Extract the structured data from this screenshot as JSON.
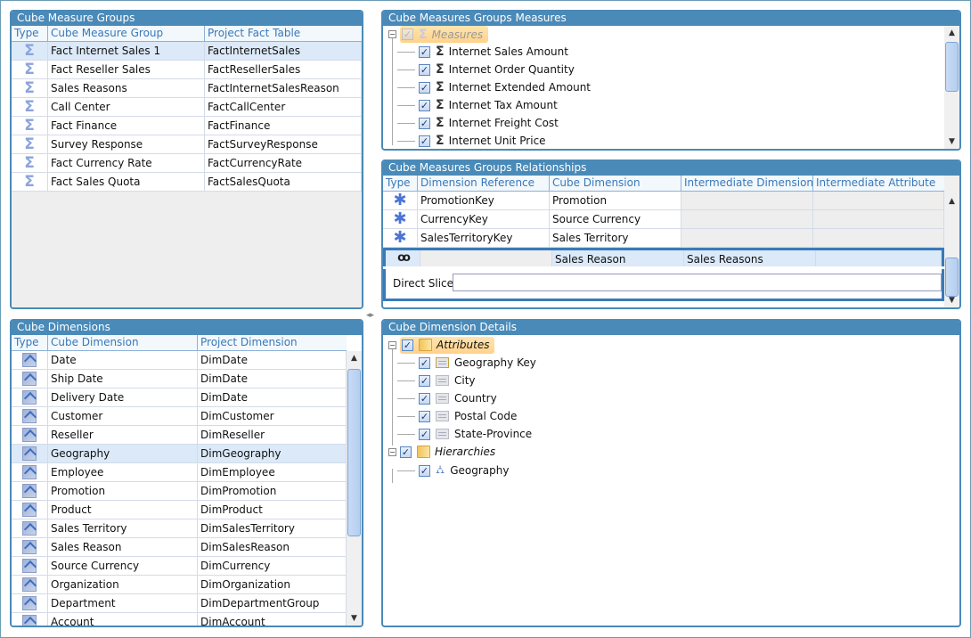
{
  "measure_groups": {
    "title": "Cube Measure Groups",
    "columns": [
      "Type",
      "Cube Measure Group",
      "Project Fact Table"
    ],
    "rows": [
      {
        "icon": "sigma-icon",
        "name": "Fact Internet Sales 1",
        "table": "FactInternetSales",
        "selected": true
      },
      {
        "icon": "sigma-icon",
        "name": "Fact Reseller Sales",
        "table": "FactResellerSales"
      },
      {
        "icon": "sigma-icon",
        "name": "Sales Reasons",
        "table": "FactInternetSalesReason"
      },
      {
        "icon": "sigma-icon",
        "name": "Call Center",
        "table": "FactCallCenter"
      },
      {
        "icon": "sigma-icon",
        "name": "Fact Finance",
        "table": "FactFinance"
      },
      {
        "icon": "sigma-icon",
        "name": "Survey Response",
        "table": "FactSurveyResponse"
      },
      {
        "icon": "sigma-icon",
        "name": "Fact Currency Rate",
        "table": "FactCurrencyRate"
      },
      {
        "icon": "sigma-icon",
        "name": "Fact Sales Quota",
        "table": "FactSalesQuota"
      }
    ]
  },
  "measures": {
    "title": "Cube Measures Groups Measures",
    "root": {
      "label": "Measures",
      "expander": "−",
      "check": "✓"
    },
    "items": [
      {
        "label": "Internet Sales Amount",
        "checked": true
      },
      {
        "label": "Internet Order Quantity",
        "checked": true
      },
      {
        "label": "Internet Extended Amount",
        "checked": true
      },
      {
        "label": "Internet Tax Amount",
        "checked": true
      },
      {
        "label": "Internet Freight Cost",
        "checked": true
      },
      {
        "label": "Internet Unit Price",
        "checked": true
      }
    ],
    "scroll_up": "▲",
    "scroll_down": "▼"
  },
  "relationships": {
    "title": "Cube Measures Groups Relationships",
    "columns": [
      "Type",
      "Dimension Reference",
      "Cube Dimension",
      "Intermediate Dimension",
      "Intermediate Attribute"
    ],
    "rows": [
      {
        "icon": "regular-relationship-icon",
        "ref": "PromotionKey",
        "dim": "Promotion",
        "inter_dim": "",
        "inter_attr": ""
      },
      {
        "icon": "regular-relationship-icon",
        "ref": "CurrencyKey",
        "dim": "Source Currency",
        "inter_dim": "",
        "inter_attr": ""
      },
      {
        "icon": "regular-relationship-icon",
        "ref": "SalesTerritoryKey",
        "dim": "Sales Territory",
        "inter_dim": "",
        "inter_attr": ""
      },
      {
        "icon": "many-to-many-icon",
        "ref": "",
        "dim": "Sales Reason",
        "inter_dim": "Sales Reasons",
        "inter_attr": "",
        "selected": true
      }
    ],
    "direct_slice_label": "Direct Slice:",
    "direct_slice_value": "",
    "scroll_up": "▲",
    "scroll_down": "▼"
  },
  "dimensions": {
    "title": "Cube Dimensions",
    "columns": [
      "Type",
      "Cube Dimension",
      "Project Dimension"
    ],
    "rows": [
      {
        "name": "Date",
        "project": "DimDate"
      },
      {
        "name": "Ship Date",
        "project": "DimDate"
      },
      {
        "name": "Delivery Date",
        "project": "DimDate"
      },
      {
        "name": "Customer",
        "project": "DimCustomer"
      },
      {
        "name": "Reseller",
        "project": "DimReseller"
      },
      {
        "name": "Geography",
        "project": "DimGeography",
        "selected": true
      },
      {
        "name": "Employee",
        "project": "DimEmployee"
      },
      {
        "name": "Promotion",
        "project": "DimPromotion"
      },
      {
        "name": "Product",
        "project": "DimProduct"
      },
      {
        "name": "Sales Territory",
        "project": "DimSalesTerritory"
      },
      {
        "name": "Sales Reason",
        "project": "DimSalesReason"
      },
      {
        "name": "Source Currency",
        "project": "DimCurrency"
      },
      {
        "name": "Organization",
        "project": "DimOrganization"
      },
      {
        "name": "Department",
        "project": "DimDepartmentGroup"
      },
      {
        "name": "Account",
        "project": "DimAccount"
      }
    ],
    "scroll_up": "▲",
    "scroll_down": "▼"
  },
  "dimension_details": {
    "title": "Cube Dimension Details",
    "attributes_label": "Attributes",
    "attributes": [
      {
        "label": "Geography Key",
        "icon": "key-attribute-icon"
      },
      {
        "label": "City",
        "icon": "attribute-icon"
      },
      {
        "label": "Country",
        "icon": "attribute-icon"
      },
      {
        "label": "Postal Code",
        "icon": "attribute-icon"
      },
      {
        "label": "State-Province",
        "icon": "attribute-icon"
      }
    ],
    "hierarchies_label": "Hierarchies",
    "hierarchies": [
      {
        "label": "Geography",
        "icon": "hierarchy-icon"
      }
    ],
    "expander": "−",
    "check": "✓"
  },
  "splitter_glyph": "◂▸"
}
